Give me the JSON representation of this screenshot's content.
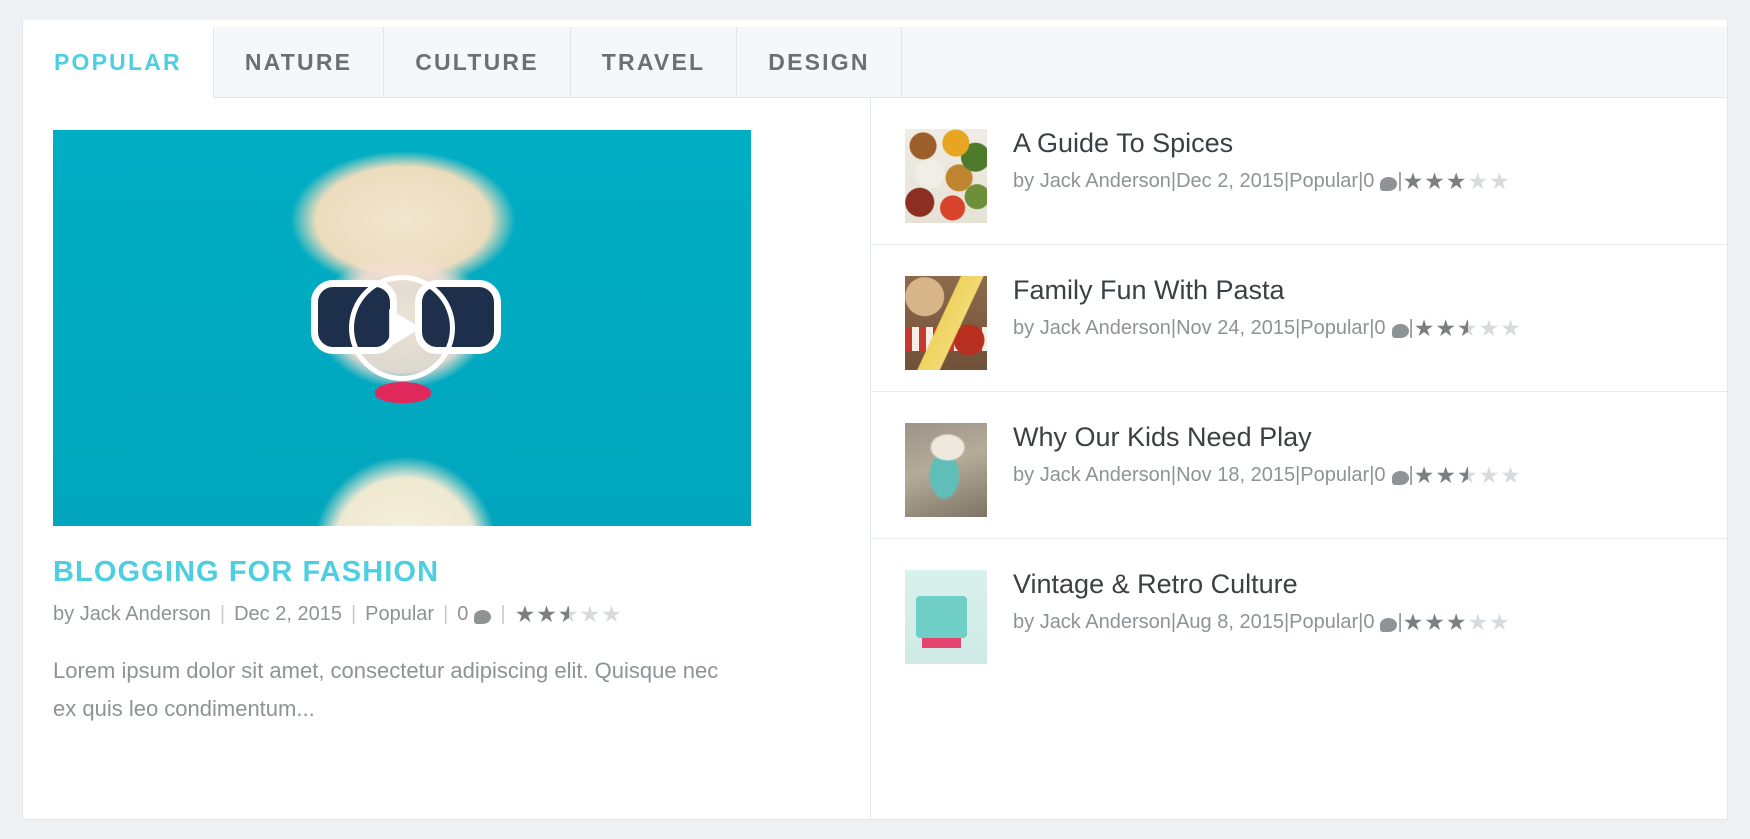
{
  "theme": {
    "accent_color": "#4ecfe0",
    "featured_image_color": "#01aec4",
    "star_filled_color": "#7a7f82",
    "star_empty_color": "#d7dbdd"
  },
  "tabs": [
    {
      "label": "POPULAR",
      "active": true
    },
    {
      "label": "NATURE",
      "active": false
    },
    {
      "label": "CULTURE",
      "active": false
    },
    {
      "label": "TRAVEL",
      "active": false
    },
    {
      "label": "DESIGN",
      "active": false
    }
  ],
  "featured": {
    "media_type": "video",
    "play_icon": "play-icon",
    "title": "BLOGGING FOR FASHION",
    "meta": {
      "author_prefix": "by",
      "author": "Jack Anderson",
      "date": "Dec 2, 2015",
      "category": "Popular",
      "comment_count": "0",
      "comment_icon": "comment-icon",
      "separator": "|",
      "rating": 2.5
    },
    "excerpt": "Lorem ipsum dolor sit amet, consectetur adipiscing elit. Quisque nec ex quis leo condimentum..."
  },
  "sidebar": {
    "items": [
      {
        "title": "A Guide To Spices",
        "thumb": "spices-thumbnail",
        "author_prefix": "by",
        "author": "Jack Anderson",
        "date": "Dec 2, 2015",
        "category": "Popular",
        "comment_count": "0",
        "separator": "|",
        "rating": 3
      },
      {
        "title": "Family Fun With Pasta",
        "thumb": "pasta-thumbnail",
        "author_prefix": "by",
        "author": "Jack Anderson",
        "date": "Nov 24, 2015",
        "category": "Popular",
        "comment_count": "0",
        "separator": "|",
        "rating": 2.5
      },
      {
        "title": "Why Our Kids Need Play",
        "thumb": "kids-thumbnail",
        "author_prefix": "by",
        "author": "Jack Anderson",
        "date": "Nov 18, 2015",
        "category": "Popular",
        "comment_count": "0",
        "separator": "|",
        "rating": 2.5
      },
      {
        "title": "Vintage & Retro Culture",
        "thumb": "vintage-thumbnail",
        "author_prefix": "by",
        "author": "Jack Anderson",
        "date": "Aug 8, 2015",
        "category": "Popular",
        "comment_count": "0",
        "separator": "|",
        "rating": 3
      }
    ]
  }
}
